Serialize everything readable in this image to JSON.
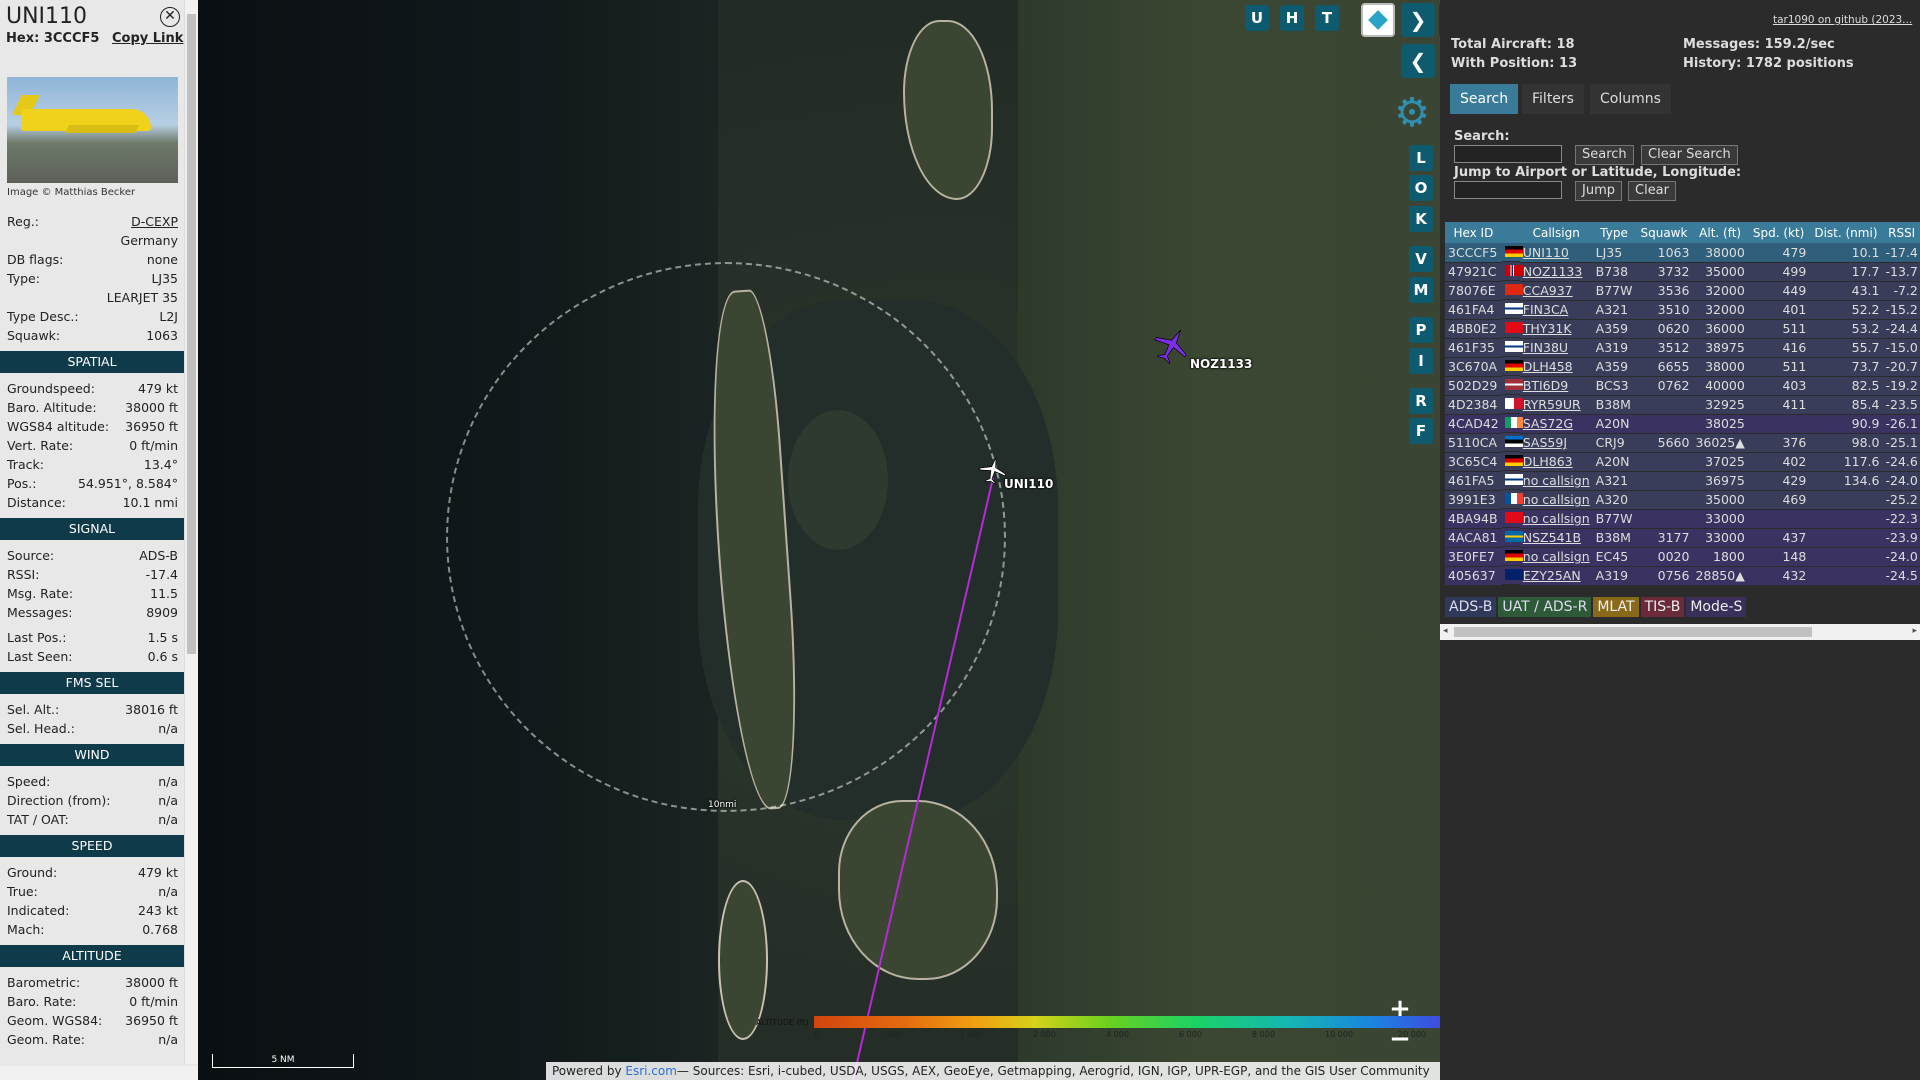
{
  "sel": {
    "callsign": "UNI110",
    "hex_label": "Hex:",
    "hex": "3CCCF5",
    "copy_link": "Copy Link",
    "photo_credit": "Image © Matthias Becker",
    "details": [
      {
        "k": "Reg.:",
        "v": "D-CEXP",
        "u": true
      },
      {
        "k": "",
        "v": "Germany"
      },
      {
        "k": "DB flags:",
        "v": "none"
      },
      {
        "k": "Type:",
        "v": "LJ35"
      },
      {
        "k": "",
        "v": "LEARJET 35"
      },
      {
        "k": "Type Desc.:",
        "v": "L2J"
      },
      {
        "k": "Squawk:",
        "v": "1063"
      }
    ],
    "spatial_title": "SPATIAL",
    "spatial": [
      {
        "k": "Groundspeed:",
        "v": "479 kt"
      },
      {
        "k": "Baro. Altitude:",
        "v": "38000 ft"
      },
      {
        "k": "WGS84 altitude:",
        "v": "36950 ft"
      },
      {
        "k": "Vert. Rate:",
        "v": "0 ft/min"
      },
      {
        "k": "Track:",
        "v": "13.4°"
      },
      {
        "k": "Pos.:",
        "v": "54.951°, 8.584°"
      },
      {
        "k": "Distance:",
        "v": "10.1 nmi"
      }
    ],
    "signal_title": "SIGNAL",
    "signal": [
      {
        "k": "Source:",
        "v": "ADS-B"
      },
      {
        "k": "RSSI:",
        "v": "-17.4"
      },
      {
        "k": "Msg. Rate:",
        "v": "11.5"
      },
      {
        "k": "Messages:",
        "v": "8909"
      },
      {
        "k": "Last Pos.:",
        "v": "1.5 s"
      },
      {
        "k": "Last Seen:",
        "v": "0.6 s"
      }
    ],
    "fms_title": "FMS SEL",
    "fms": [
      {
        "k": "Sel. Alt.:",
        "v": "38016 ft"
      },
      {
        "k": "Sel. Head.:",
        "v": "n/a"
      }
    ],
    "wind_title": "WIND",
    "wind": [
      {
        "k": "Speed:",
        "v": "n/a"
      },
      {
        "k": "Direction (from):",
        "v": "n/a"
      },
      {
        "k": "TAT / OAT:",
        "v": "n/a"
      }
    ],
    "speed_title": "SPEED",
    "speed": [
      {
        "k": "Ground:",
        "v": "479 kt"
      },
      {
        "k": "True:",
        "v": "n/a"
      },
      {
        "k": "Indicated:",
        "v": "243 kt"
      },
      {
        "k": "Mach:",
        "v": "0.768"
      }
    ],
    "altitude_title": "ALTITUDE",
    "altitude": [
      {
        "k": "Barometric:",
        "v": "38000 ft"
      },
      {
        "k": "Baro. Rate:",
        "v": "0 ft/min"
      },
      {
        "k": "Geom. WGS84:",
        "v": "36950 ft"
      },
      {
        "k": "Geom. Rate:",
        "v": "n/a"
      }
    ]
  },
  "map": {
    "planes": [
      {
        "label": "UNI110",
        "color": "#ffffff"
      },
      {
        "label": "NOZ1133",
        "color": "#7a2ee6"
      }
    ],
    "ring_label": "10nmi",
    "buttons_top": [
      "U",
      "H",
      "T"
    ],
    "buttons_side": [
      "L",
      "O",
      "K",
      "V",
      "M",
      "P",
      "I",
      "R",
      "F"
    ],
    "zoom_in": "+",
    "zoom_out": "−",
    "altitude_legend_label": "ALTITUDE (ft)",
    "altitude_ticks": [
      "0",
      "500",
      "1 000",
      "2 000",
      "4 000",
      "6 000",
      "8 000",
      "10 000",
      "20 000",
      "30 000",
      "40 000+"
    ],
    "scale_label": "5 NM",
    "attribution_prefix": "Powered by ",
    "attribution_link": "Esri.com",
    "attribution_rest": "— Sources: Esri, i-cubed, USDA, USGS, AEX, GeoEye, Getmapping, Aerogrid, IGN, IGP, UPR-EGP, and the GIS User Community"
  },
  "stats": {
    "total_aircraft": "Total Aircraft: 18",
    "with_position": "With Position: 13",
    "messages": "Messages: 159.2/sec",
    "history": "History: 1782 positions",
    "github": "tar1090 on github (2023..."
  },
  "tabs": [
    "Search",
    "Filters",
    "Columns"
  ],
  "search": {
    "label": "Search:",
    "search_btn": "Search",
    "clear_btn": "Clear Search",
    "jump_label": "Jump to Airport or Latitude, Longitude:",
    "jump_btn": "Jump",
    "clear2_btn": "Clear"
  },
  "table": {
    "headers": [
      "Hex ID",
      "",
      "Callsign",
      "Type",
      "Squawk",
      "Alt. (ft)",
      "Spd. (kt)",
      "Dist. (nmi)",
      "RSSI"
    ],
    "rows": [
      {
        "hex": "3CCCF5",
        "flag": "de",
        "cs": "UNI110",
        "type": "LJ35",
        "sq": "1063",
        "alt": "38000",
        "spd": "479",
        "dist": "10.1",
        "rssi": "-17.4",
        "cls": "r-adsb sel"
      },
      {
        "hex": "47921C",
        "flag": "no",
        "cs": "NOZ1133",
        "type": "B738",
        "sq": "3732",
        "alt": "35000",
        "spd": "499",
        "dist": "17.7",
        "rssi": "-13.7",
        "cls": "r-adsb"
      },
      {
        "hex": "78076E",
        "flag": "cn",
        "cs": "CCA937",
        "type": "B77W",
        "sq": "3536",
        "alt": "32000",
        "spd": "449",
        "dist": "43.1",
        "rssi": "-7.2",
        "cls": "r-adsb"
      },
      {
        "hex": "461FA4",
        "flag": "fi",
        "cs": "FIN3CA",
        "type": "A321",
        "sq": "3510",
        "alt": "32000",
        "spd": "401",
        "dist": "52.2",
        "rssi": "-15.2",
        "cls": "r-adsb"
      },
      {
        "hex": "4BB0E2",
        "flag": "tr",
        "cs": "THY31K",
        "type": "A359",
        "sq": "0620",
        "alt": "36000",
        "spd": "511",
        "dist": "53.2",
        "rssi": "-24.4",
        "cls": "r-adsb"
      },
      {
        "hex": "461F35",
        "flag": "fi",
        "cs": "FIN38U",
        "type": "A319",
        "sq": "3512",
        "alt": "38975",
        "spd": "416",
        "dist": "55.7",
        "rssi": "-15.0",
        "cls": "r-adsb"
      },
      {
        "hex": "3C670A",
        "flag": "de",
        "cs": "DLH458",
        "type": "A359",
        "sq": "6655",
        "alt": "38000",
        "spd": "511",
        "dist": "73.7",
        "rssi": "-20.7",
        "cls": "r-adsb"
      },
      {
        "hex": "502D29",
        "flag": "lv",
        "cs": "BTI6D9",
        "type": "BCS3",
        "sq": "0762",
        "alt": "40000",
        "spd": "403",
        "dist": "82.5",
        "rssi": "-19.2",
        "cls": "r-adsb"
      },
      {
        "hex": "4D2384",
        "flag": "mt",
        "cs": "RYR59UR",
        "type": "B38M",
        "sq": "",
        "alt": "32925",
        "spd": "411",
        "dist": "85.4",
        "rssi": "-23.5",
        "cls": "r-adsb"
      },
      {
        "hex": "4CAD42",
        "flag": "ie",
        "cs": "SAS72G",
        "type": "A20N",
        "sq": "",
        "alt": "38025",
        "spd": "",
        "dist": "90.9",
        "rssi": "-26.1",
        "cls": "r-mode"
      },
      {
        "hex": "5110CA",
        "flag": "ee",
        "cs": "SAS59J",
        "type": "CRJ9",
        "sq": "5660",
        "alt": "36025▲",
        "spd": "376",
        "dist": "98.0",
        "rssi": "-25.1",
        "cls": "r-adsb"
      },
      {
        "hex": "3C65C4",
        "flag": "de",
        "cs": "DLH863",
        "type": "A20N",
        "sq": "",
        "alt": "37025",
        "spd": "402",
        "dist": "117.6",
        "rssi": "-24.6",
        "cls": "r-adsb"
      },
      {
        "hex": "461FA5",
        "flag": "fi",
        "cs": "no callsign",
        "type": "A321",
        "sq": "",
        "alt": "36975",
        "spd": "429",
        "dist": "134.6",
        "rssi": "-24.0",
        "cls": "r-adsb"
      },
      {
        "hex": "3991E3",
        "flag": "fr",
        "cs": "no callsign",
        "type": "A320",
        "sq": "",
        "alt": "35000",
        "spd": "469",
        "dist": "",
        "rssi": "-25.2",
        "cls": "r-adsb"
      },
      {
        "hex": "4BA94B",
        "flag": "tr",
        "cs": "no callsign",
        "type": "B77W",
        "sq": "",
        "alt": "33000",
        "spd": "",
        "dist": "",
        "rssi": "-22.3",
        "cls": "r-mode"
      },
      {
        "hex": "4ACA81",
        "flag": "se",
        "cs": "NSZ541B",
        "type": "B38M",
        "sq": "3177",
        "alt": "33000",
        "spd": "437",
        "dist": "",
        "rssi": "-23.9",
        "cls": "r-mode"
      },
      {
        "hex": "3E0FE7",
        "flag": "de",
        "cs": "no callsign",
        "type": "EC45",
        "sq": "0020",
        "alt": "1800",
        "spd": "148",
        "dist": "",
        "rssi": "-24.0",
        "cls": "r-mode"
      },
      {
        "hex": "405637",
        "flag": "gb",
        "cs": "EZY25AN",
        "type": "A319",
        "sq": "0756",
        "alt": "28850▲",
        "spd": "432",
        "dist": "",
        "rssi": "-24.5",
        "cls": "r-mode"
      }
    ]
  },
  "source_legend": [
    {
      "label": "ADS-B",
      "bg": "#2f3a5a",
      "fg": "#dde"
    },
    {
      "label": "UAT / ADS-R",
      "bg": "#2f5a3a",
      "fg": "#dde"
    },
    {
      "label": "MLAT",
      "bg": "#8a6a1a",
      "fg": "#eee"
    },
    {
      "label": "TIS-B",
      "bg": "#6a2a3a",
      "fg": "#eee"
    },
    {
      "label": "Mode-S",
      "bg": "#3a2f5a",
      "fg": "#eee"
    }
  ],
  "colors": {
    "accent": "#3b7b9a",
    "sidebar_header": "#0e3a4a",
    "selected_track": "#b62ad6"
  }
}
